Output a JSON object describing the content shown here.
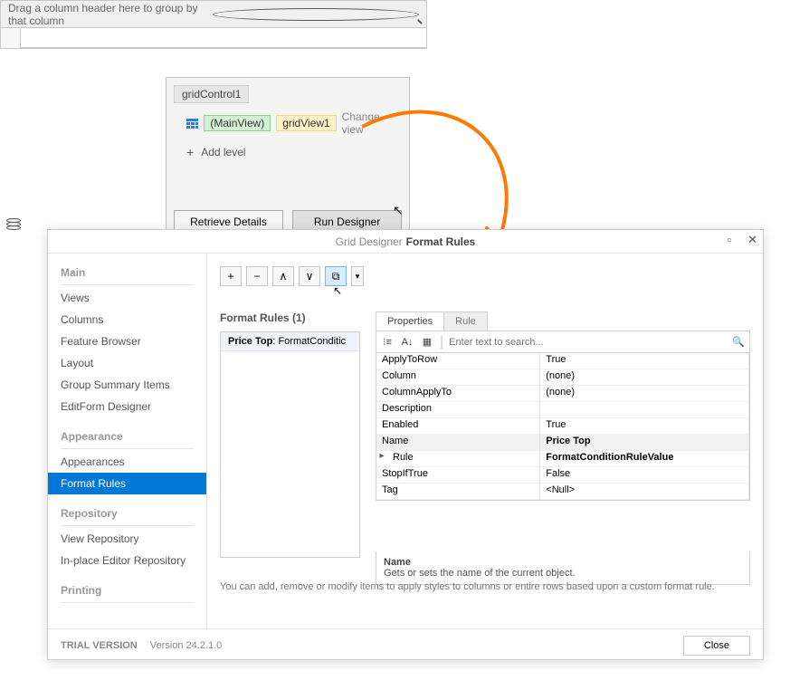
{
  "grid": {
    "group_hint": "Drag a column header here to group by that column"
  },
  "smart_panel": {
    "grid_label": "gridControl1",
    "main_view": "(MainView)",
    "view_instance": "gridView1",
    "change_view": "Change view",
    "add_level": "Add level",
    "retrieve_details": "Retrieve Details",
    "run_designer": "Run Designer"
  },
  "designer": {
    "title_prefix": "Grid Designer",
    "title_section": "Format Rules",
    "sidebar": {
      "categories": {
        "main": "Main",
        "appearance": "Appearance",
        "repository": "Repository",
        "printing": "Printing"
      },
      "items": {
        "views": "Views",
        "columns": "Columns",
        "feature_browser": "Feature Browser",
        "layout": "Layout",
        "group_summary": "Group Summary Items",
        "editform": "EditForm Designer",
        "appearances": "Appearances",
        "format_rules": "Format Rules",
        "view_repo": "View Repository",
        "inplace_repo": "In-place Editor Repository"
      }
    },
    "toolbar": {
      "add": "+",
      "remove": "−",
      "up": "∧",
      "down": "∨",
      "copy": "⧉",
      "drop": "▾"
    },
    "format_list": {
      "title": "Format Rules (1)",
      "item_name": "Price Top",
      "item_type": "FormatConditic"
    },
    "propgrid": {
      "tab_props": "Properties",
      "tab_rule": "Rule",
      "search_placeholder": "Enter text to search...",
      "rows": [
        {
          "k": "ApplyToRow",
          "v": "True"
        },
        {
          "k": "Column",
          "v": "(none)"
        },
        {
          "k": "ColumnApplyTo",
          "v": "(none)"
        },
        {
          "k": "Description",
          "v": ""
        },
        {
          "k": "Enabled",
          "v": "True"
        },
        {
          "k": "Name",
          "v": "Price Top",
          "hi": true,
          "bold": true
        },
        {
          "k": "Rule",
          "v": "FormatConditionRuleValue",
          "bold": true,
          "arrow": true
        },
        {
          "k": "StopIfTrue",
          "v": "False"
        },
        {
          "k": "Tag",
          "v": "<Null>"
        }
      ],
      "desc_title": "Name",
      "desc_text": "Gets or sets the name of the current object."
    },
    "hint": "You can add, remove or modify items to apply styles to columns or entire rows based upon a custom format rule.",
    "footer": {
      "trial": "TRIAL VERSION",
      "version": "Version 24.2.1.0",
      "close": "Close"
    }
  }
}
